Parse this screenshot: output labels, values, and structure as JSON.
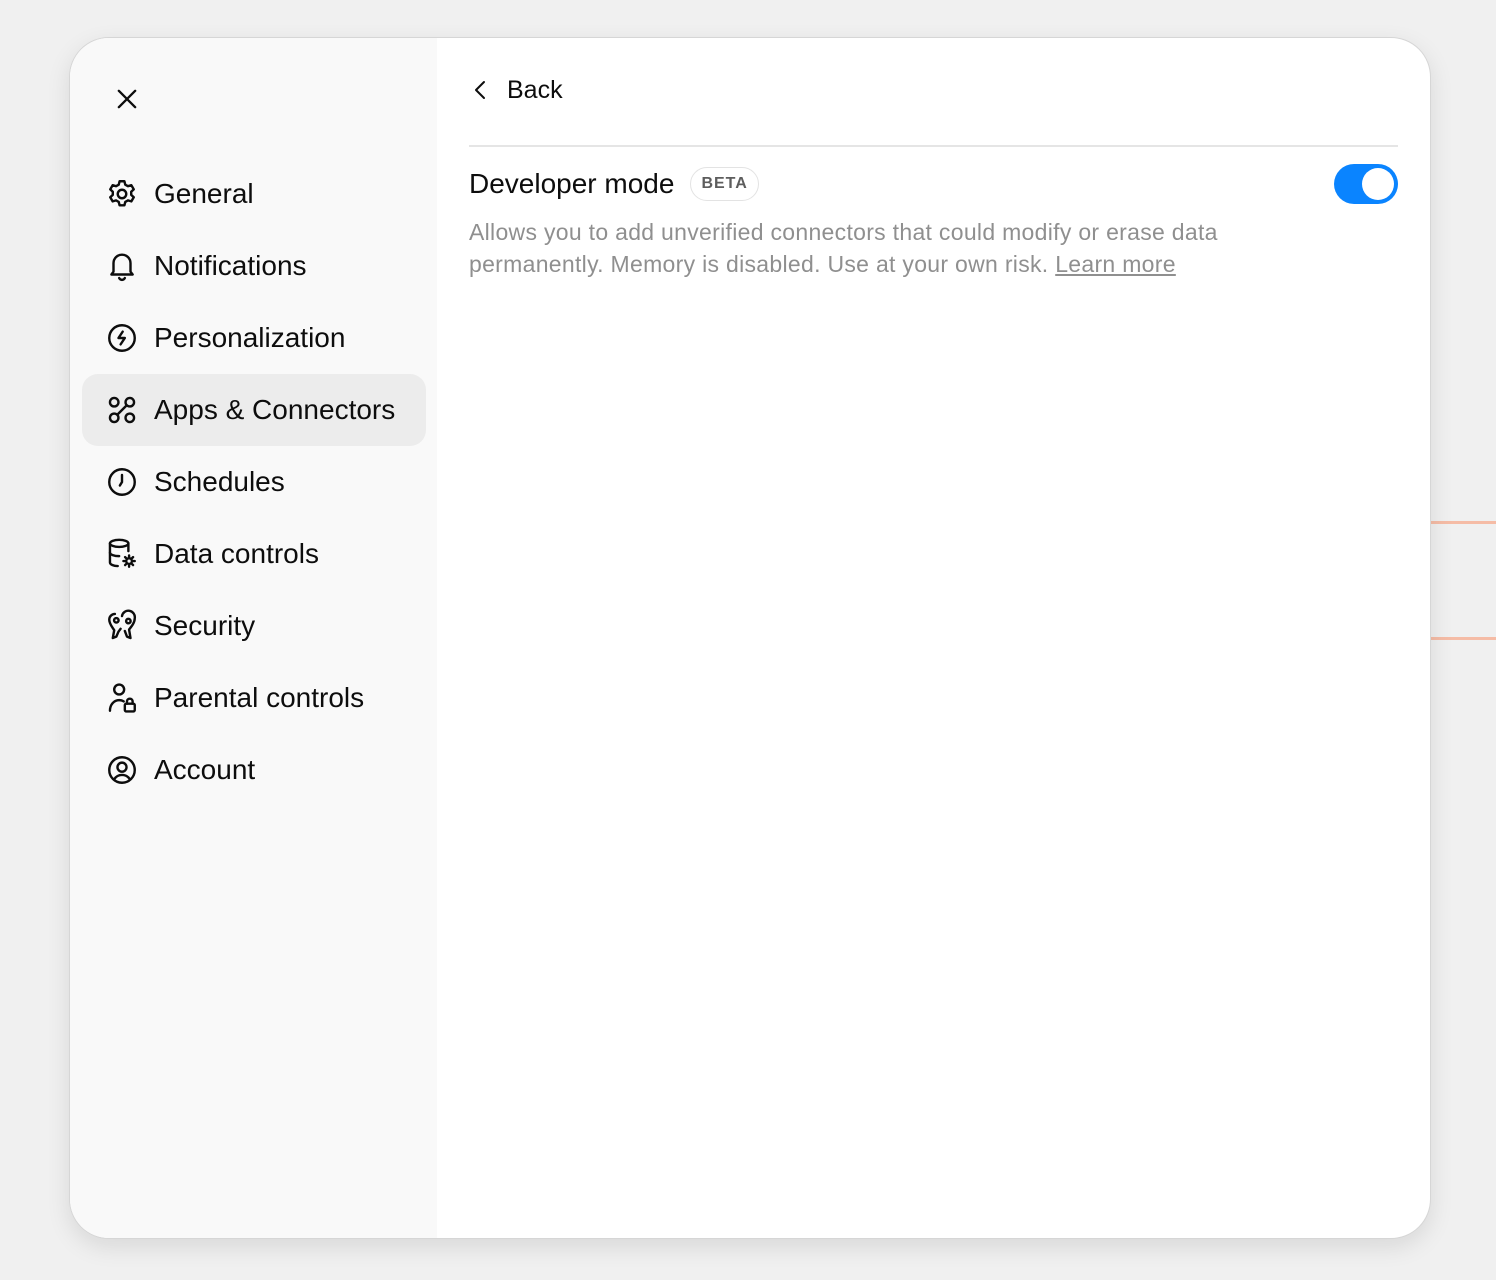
{
  "sidebar": {
    "close_label": "Close",
    "items": [
      {
        "label": "General",
        "icon": "gear-icon"
      },
      {
        "label": "Notifications",
        "icon": "bell-icon"
      },
      {
        "label": "Personalization",
        "icon": "personalization-icon"
      },
      {
        "label": "Apps & Connectors",
        "icon": "apps-icon",
        "active": true
      },
      {
        "label": "Schedules",
        "icon": "clock-icon"
      },
      {
        "label": "Data controls",
        "icon": "database-gear-icon"
      },
      {
        "label": "Security",
        "icon": "security-icon"
      },
      {
        "label": "Parental controls",
        "icon": "parental-lock-icon"
      },
      {
        "label": "Account",
        "icon": "account-icon"
      }
    ]
  },
  "main": {
    "back_label": "Back",
    "setting": {
      "title": "Developer mode",
      "badge": "BETA",
      "enabled": true,
      "description": "Allows you to add unverified connectors that could modify or erase data permanently. Memory is disabled. Use at your own risk.",
      "link_label": "Learn more"
    }
  },
  "colors": {
    "accent": "#0a84ff",
    "sidebar_bg": "#f9f9f9",
    "active_item_bg": "#ececec",
    "muted_text": "#8f8f8f"
  }
}
